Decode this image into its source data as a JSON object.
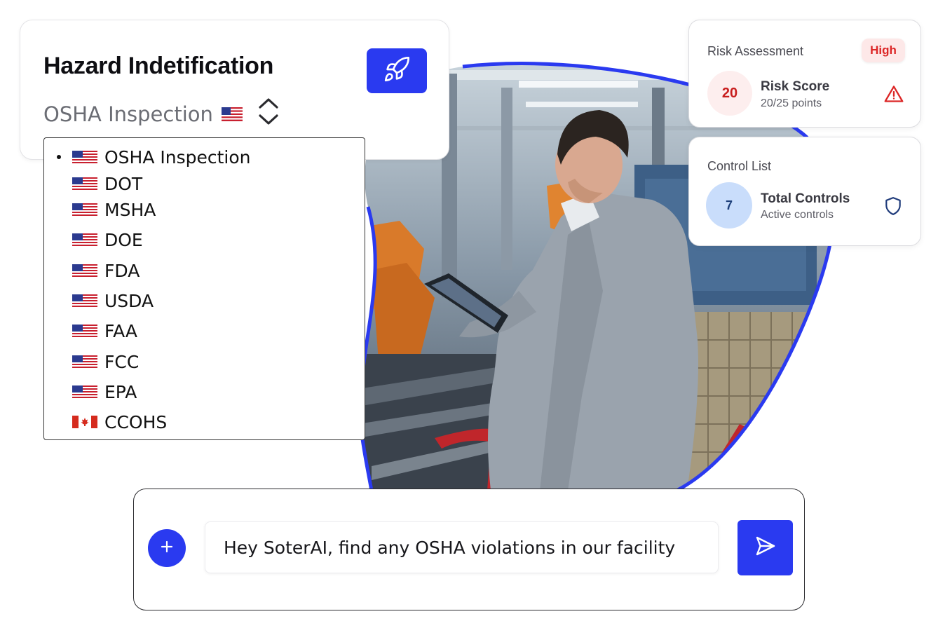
{
  "hazard_card": {
    "title": "Hazard Indetification",
    "selected_option": "OSHA Inspection",
    "selected_flag": "us-flag-icon",
    "action_icon": "rocket-icon"
  },
  "dropdown": {
    "items": [
      {
        "label": "OSHA Inspection",
        "flag": "us-flag-icon",
        "selected": true
      },
      {
        "label": "DOT",
        "flag": "us-flag-icon",
        "selected": false
      },
      {
        "label": "MSHA",
        "flag": "us-flag-icon",
        "selected": false
      },
      {
        "label": "DOE",
        "flag": "us-flag-icon",
        "selected": false
      },
      {
        "label": "FDA",
        "flag": "us-flag-icon",
        "selected": false
      },
      {
        "label": "USDA",
        "flag": "us-flag-icon",
        "selected": false
      },
      {
        "label": "FAA",
        "flag": "us-flag-icon",
        "selected": false
      },
      {
        "label": "FCC",
        "flag": "us-flag-icon",
        "selected": false
      },
      {
        "label": "EPA",
        "flag": "us-flag-icon",
        "selected": false
      },
      {
        "label": "CCOHS",
        "flag": "canada-flag-icon",
        "selected": false
      }
    ]
  },
  "risk_card": {
    "heading": "Risk Assessment",
    "badge": "High",
    "score": "20",
    "title": "Risk Score",
    "subtitle": "20/25 points",
    "icon": "warning-triangle-icon"
  },
  "control_card": {
    "heading": "Control List",
    "count": "7",
    "title": "Total Controls",
    "subtitle": "Active controls",
    "icon": "shield-icon"
  },
  "prompt": {
    "text": "Hey SoterAI, find any OSHA violations in our facility",
    "add_icon": "plus-icon",
    "send_icon": "send-icon"
  },
  "colors": {
    "accent": "#2a3af0",
    "danger": "#dc2626",
    "control_circle": "#c9ddfb"
  }
}
